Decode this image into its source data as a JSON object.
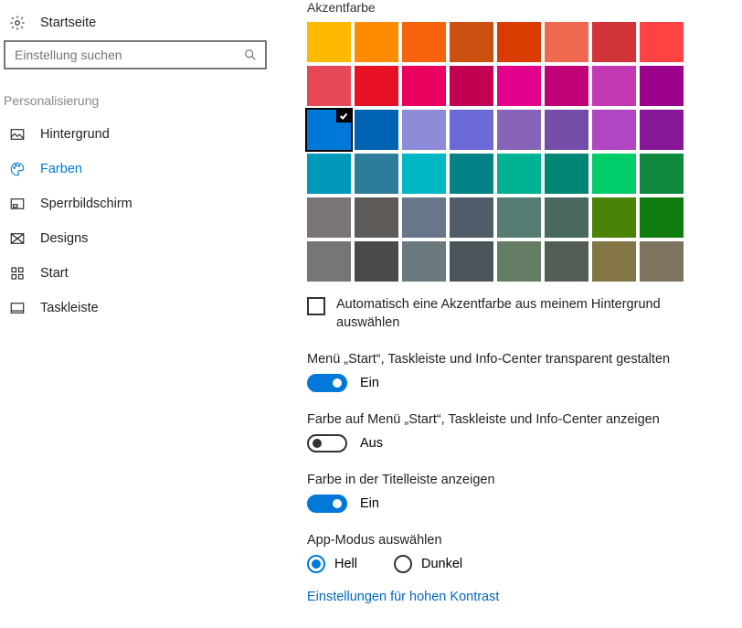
{
  "sidebar": {
    "home": "Startseite",
    "search_placeholder": "Einstellung suchen",
    "group": "Personalisierung",
    "items": [
      {
        "label": "Hintergrund"
      },
      {
        "label": "Farben"
      },
      {
        "label": "Sperrbildschirm"
      },
      {
        "label": "Designs"
      },
      {
        "label": "Start"
      },
      {
        "label": "Taskleiste"
      }
    ]
  },
  "main": {
    "accent_title": "Akzentfarbe",
    "auto_pick_label": "Automatisch eine Akzentfarbe aus meinem Hintergrund auswählen",
    "auto_pick_checked": false,
    "transparency_label": "Menü „Start“, Taskleiste und Info-Center transparent gestalten",
    "transparency_state": "Ein",
    "show_color_label": "Farbe auf Menü „Start“, Taskleiste und Info-Center anzeigen",
    "show_color_state": "Aus",
    "titlebar_label": "Farbe in der Titelleiste anzeigen",
    "titlebar_state": "Ein",
    "app_mode_label": "App-Modus auswählen",
    "app_mode_light": "Hell",
    "app_mode_dark": "Dunkel",
    "high_contrast_link": "Einstellungen für hohen Kontrast",
    "selected_index": 16,
    "colors": [
      "#ffb900",
      "#ff8c00",
      "#f7630c",
      "#ca5010",
      "#da3b01",
      "#ef6950",
      "#d13438",
      "#ff4343",
      "#e74856",
      "#e81123",
      "#ea005e",
      "#c30052",
      "#e3008c",
      "#bf0077",
      "#c239b3",
      "#9a0089",
      "#0078d7",
      "#0063b1",
      "#8e8cd8",
      "#6b69d6",
      "#8764b8",
      "#744da9",
      "#b146c2",
      "#881798",
      "#0099bc",
      "#2d7d9a",
      "#00b7c3",
      "#038387",
      "#00b294",
      "#018574",
      "#00cc6a",
      "#10893e",
      "#7a7574",
      "#5d5a58",
      "#68768a",
      "#515c6b",
      "#567c73",
      "#486860",
      "#498205",
      "#107c10",
      "#767676",
      "#4c4a48",
      "#69797e",
      "#4a5459",
      "#647c64",
      "#525e54",
      "#847545",
      "#7e735f"
    ]
  }
}
